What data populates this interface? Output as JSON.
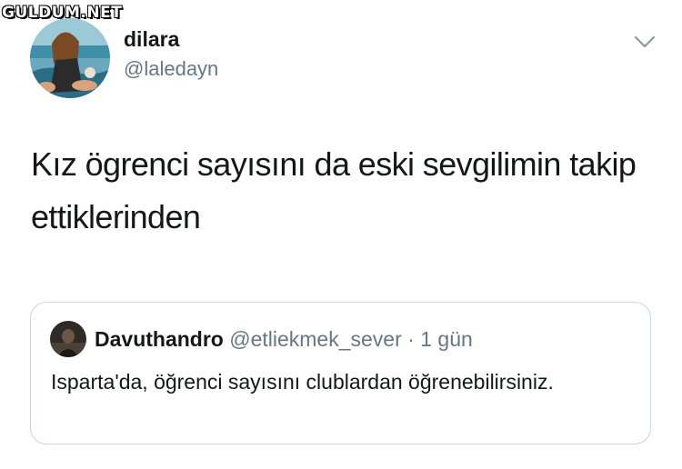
{
  "watermark": "GULDUM.NET",
  "tweet": {
    "display_name": "dilara",
    "handle": "@laledayn",
    "text": "Kız ögrenci sayısını da eski sevgilimin takip ettiklerinden"
  },
  "quoted_tweet": {
    "display_name": "Davuthandro",
    "handle": "@etliekmek_sever",
    "separator": "·",
    "time": "1 gün",
    "text": "Isparta'da, öğrenci sayısını clublardan öğrenebilirsiniz."
  },
  "icons": {
    "more": "chevron-down-icon"
  },
  "colors": {
    "text": "#14171a",
    "secondary_text": "#657786",
    "border": "#ccd6dd"
  }
}
